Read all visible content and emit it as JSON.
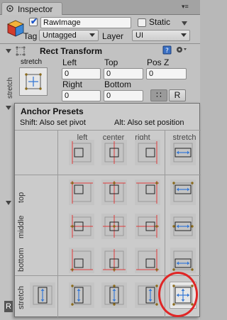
{
  "window": {
    "tab_title": "Inspector",
    "tab_menu": "▾≡"
  },
  "gameobject": {
    "active": true,
    "name": "RawImage",
    "static_label": "Static",
    "tag_label": "Tag",
    "tag_value": "Untagged",
    "layer_label": "Layer",
    "layer_value": "UI"
  },
  "rect_transform": {
    "title": "Rect Transform",
    "anchor_label": "stretch",
    "side_label": "stretch",
    "fields": {
      "left_label": "Left",
      "top_label": "Top",
      "posz_label": "Pos Z",
      "right_label": "Right",
      "bottom_label": "Bottom",
      "left": "0",
      "top": "0",
      "posz": "0",
      "right": "0",
      "bottom": "0"
    },
    "blueprint_button": "∷",
    "raw_button": "R"
  },
  "anchor_presets": {
    "title": "Anchor Presets",
    "hint_shift": "Shift: Also set pivot",
    "hint_alt": "Alt: Also set position",
    "columns": [
      "left",
      "center",
      "right",
      "stretch"
    ],
    "rows": [
      "top",
      "middle",
      "bottom",
      "stretch"
    ],
    "selected": "stretch-stretch",
    "colors": {
      "anchor_line": "#e03a3a",
      "stretch_arrow": "#3a7bd5",
      "corner_dot": "#8a6a1a",
      "highlight_circle": "#e02626"
    }
  },
  "footer_label": "R"
}
